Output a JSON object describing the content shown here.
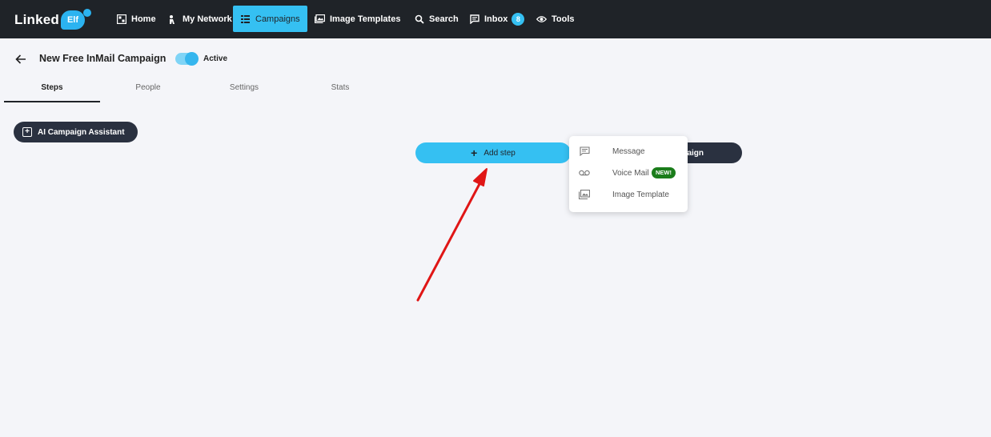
{
  "brand": {
    "text": "Linked",
    "badge": "Elf"
  },
  "nav": {
    "items": [
      {
        "label": "Home",
        "icon": "home-icon"
      },
      {
        "label": "My Network",
        "icon": "network-icon"
      },
      {
        "label": "Campaigns",
        "icon": "campaigns-icon",
        "active": true
      },
      {
        "label": "Image Templates",
        "icon": "image-icon"
      },
      {
        "label": "Search",
        "icon": "search-icon"
      },
      {
        "label": "Inbox",
        "icon": "inbox-icon",
        "count": "8"
      },
      {
        "label": "Tools",
        "icon": "eye-icon"
      }
    ]
  },
  "campaign": {
    "title": "New Free InMail Campaign",
    "status": "Active",
    "status_on": true
  },
  "tabs": [
    {
      "label": "Steps",
      "active": true
    },
    {
      "label": "People"
    },
    {
      "label": "Settings"
    },
    {
      "label": "Stats"
    }
  ],
  "ai_assistant": {
    "label": "AI Campaign Assistant"
  },
  "add_step": {
    "label": "Add step"
  },
  "hidden_button": {
    "label_fragment": "aign"
  },
  "step_menu": {
    "items": [
      {
        "label": "Message",
        "icon": "message-icon"
      },
      {
        "label": "Voice Mail",
        "icon": "voicemail-icon",
        "badge": "NEW!"
      },
      {
        "label": "Image Template",
        "icon": "image-template-icon"
      }
    ]
  },
  "colors": {
    "nav_bg": "#1f2328",
    "accent": "#35c0f2",
    "dark_button": "#2a3140",
    "new_badge": "#1b7d1b",
    "annotation_arrow": "#e01616"
  }
}
